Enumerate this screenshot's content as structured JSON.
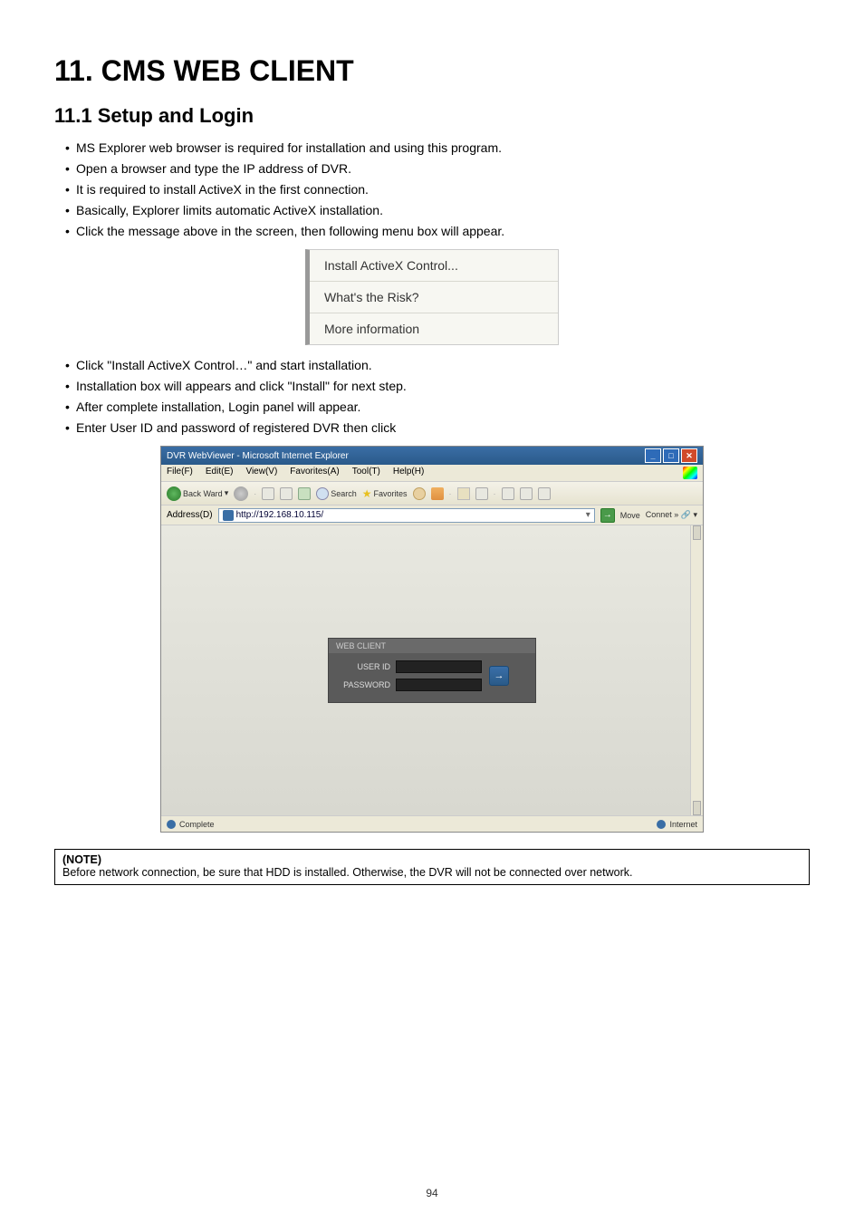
{
  "chapter": {
    "title": "11.  CMS WEB CLIENT"
  },
  "section": {
    "title": "11.1    Setup and Login"
  },
  "bullets_top": [
    "MS Explorer web browser is required for installation and using this program.",
    "Open a browser and type the IP address of DVR.",
    "It is required to install ActiveX in the first connection.",
    "Basically, Explorer limits automatic ActiveX installation.",
    "Click the message above in the screen, then following menu box will appear."
  ],
  "activex_menu": {
    "install": "Install ActiveX Control...",
    "risk": "What's the Risk?",
    "more": "More information"
  },
  "bullets_mid": [
    "Click \"Install ActiveX Control…\" and start installation.",
    "Installation box will appears and click \"Install\" for next step.",
    "After complete installation, Login panel will appear.",
    "Enter User ID and password of registered DVR then click"
  ],
  "ie_window": {
    "title": "DVR WebViewer - Microsoft Internet Explorer",
    "menu": {
      "file": "File(F)",
      "edit": "Edit(E)",
      "view": "View(V)",
      "favorites": "Favorites(A)",
      "tools": "Tool(T)",
      "help": "Help(H)"
    },
    "toolbar": {
      "back": "Back Ward",
      "search": "Search",
      "favorites": "Favorites"
    },
    "address": {
      "label": "Address(D)",
      "value": "http://192.168.10.115/",
      "move": "Move",
      "connect": "Connet"
    },
    "login": {
      "title": "WEB CLIENT",
      "user_label": "USER ID",
      "pass_label": "PASSWORD",
      "submit": "→"
    },
    "status": {
      "left": "Complete",
      "right": "Internet"
    }
  },
  "note": {
    "title": "(NOTE)",
    "body": "Before network connection, be sure that HDD is installed. Otherwise, the DVR will not be connected over network."
  },
  "page_number": "94"
}
